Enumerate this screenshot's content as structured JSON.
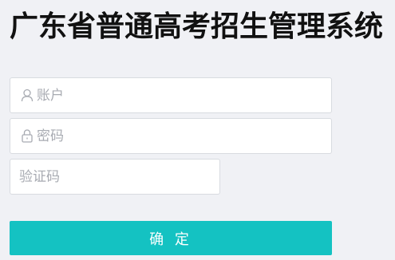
{
  "header": {
    "title": "广东省普通高考招生管理系统"
  },
  "login_form": {
    "account": {
      "placeholder": "账户",
      "value": "",
      "icon": "user-icon"
    },
    "password": {
      "placeholder": "密码",
      "value": "",
      "icon": "lock-icon"
    },
    "captcha": {
      "placeholder": "验证码",
      "value": ""
    },
    "submit_label": "确 定"
  },
  "colors": {
    "background": "#f0f1f5",
    "accent": "#14c2c2",
    "input_border": "#d8dbe0",
    "placeholder": "#a8abb2"
  }
}
